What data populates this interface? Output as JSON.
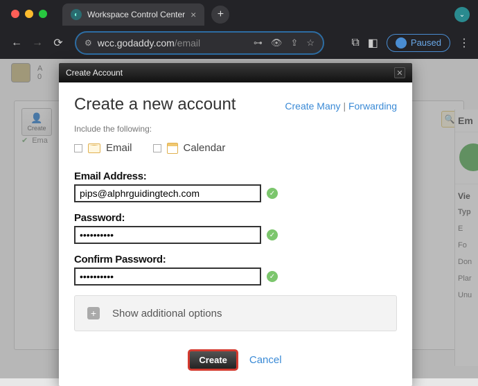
{
  "browser": {
    "tab_title": "Workspace Control Center",
    "url_host": "wcc.godaddy.com",
    "url_path": "/email",
    "paused_label": "Paused"
  },
  "bg": {
    "create_label": "Create",
    "row_label": "Ema",
    "right_header": "Em",
    "right_section": "Vie",
    "right_type": "Typ",
    "items": [
      "E",
      "Fo",
      "Don",
      "Plar",
      "Unu"
    ]
  },
  "dialog": {
    "header": "Create Account",
    "title": "Create a new account",
    "link_create_many": "Create Many",
    "link_sep": " | ",
    "link_forwarding": "Forwarding",
    "subtitle": "Include the following:",
    "include_email": "Email",
    "include_calendar": "Calendar",
    "email_label": "Email Address:",
    "email_value": "pips@alphrguidingtech.com",
    "password_label": "Password:",
    "password_value": "••••••••••",
    "confirm_label": "Confirm Password:",
    "confirm_value": "••••••••••",
    "additional_label": "Show additional options",
    "create_btn": "Create",
    "cancel_btn": "Cancel"
  }
}
